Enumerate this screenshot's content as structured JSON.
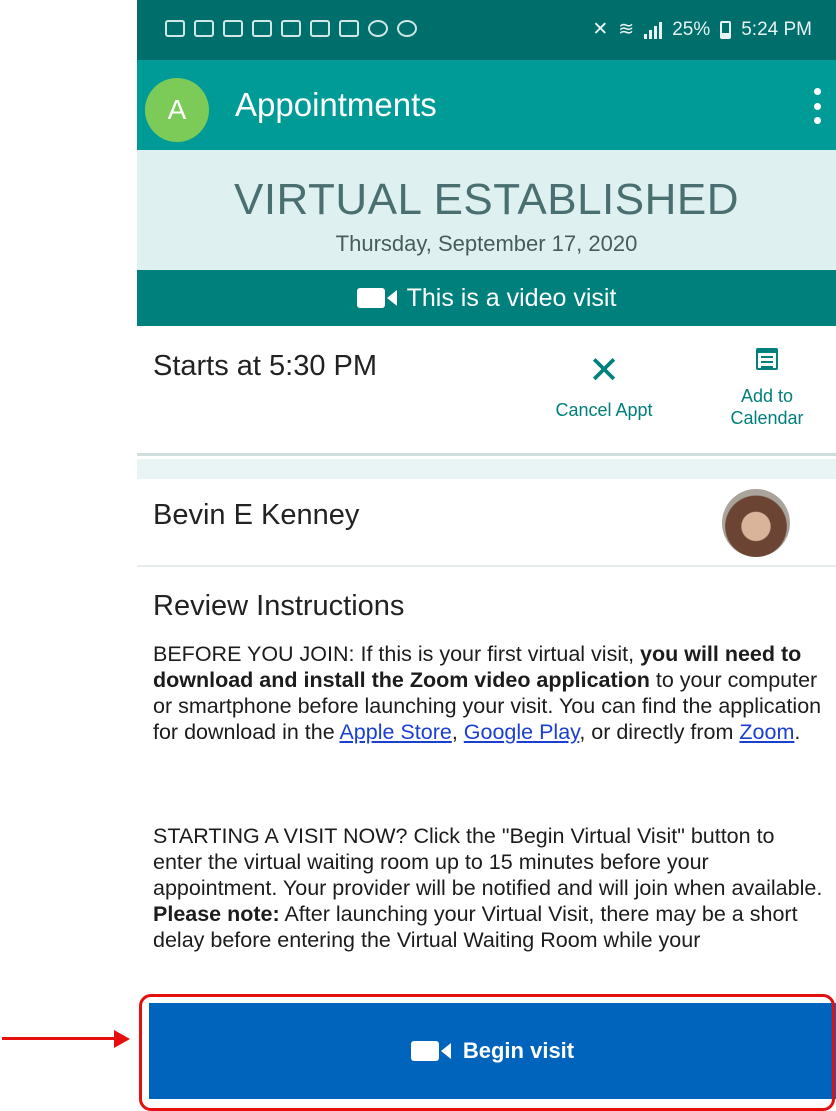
{
  "status_bar": {
    "battery": "25%",
    "time": "5:24 PM"
  },
  "app_bar": {
    "avatar_letter": "A",
    "title": "Appointments"
  },
  "appointment": {
    "type": "VIRTUAL ESTABLISHED",
    "date": "Thursday, September 17, 2020",
    "video_banner": "This is a video visit",
    "start_time": "Starts at 5:30 PM",
    "actions": {
      "cancel_label": "Cancel Appt",
      "calendar_label_1": "Add to",
      "calendar_label_2": "Calendar"
    },
    "provider_name": "Bevin E Kenney"
  },
  "instructions": {
    "title": "Review Instructions",
    "p1_a": "BEFORE YOU JOIN: If this is your first virtual visit, ",
    "p1_b": "you will need to download and install the Zoom video application",
    "p1_c": " to your computer or smartphone before launching your visit. You can find the application for download in the ",
    "link_apple": "Apple Store",
    "sep_1": ", ",
    "link_google": "Google Play",
    "p1_d": ", or directly from ",
    "link_zoom": "Zoom",
    "p1_e": ".",
    "p2_a": "STARTING A VISIT NOW? Click the \"Begin Virtual Visit\" button to enter the virtual waiting room up to 15 minutes before your appointment. Your provider will be notified and will join when available. ",
    "p2_b": "Please note:",
    "p2_c": " After launching your Virtual Visit, there may be a short delay before entering the Virtual Waiting Room while your"
  },
  "begin_button": {
    "label": "Begin visit"
  },
  "annotation": {
    "color": "#e5100d"
  }
}
